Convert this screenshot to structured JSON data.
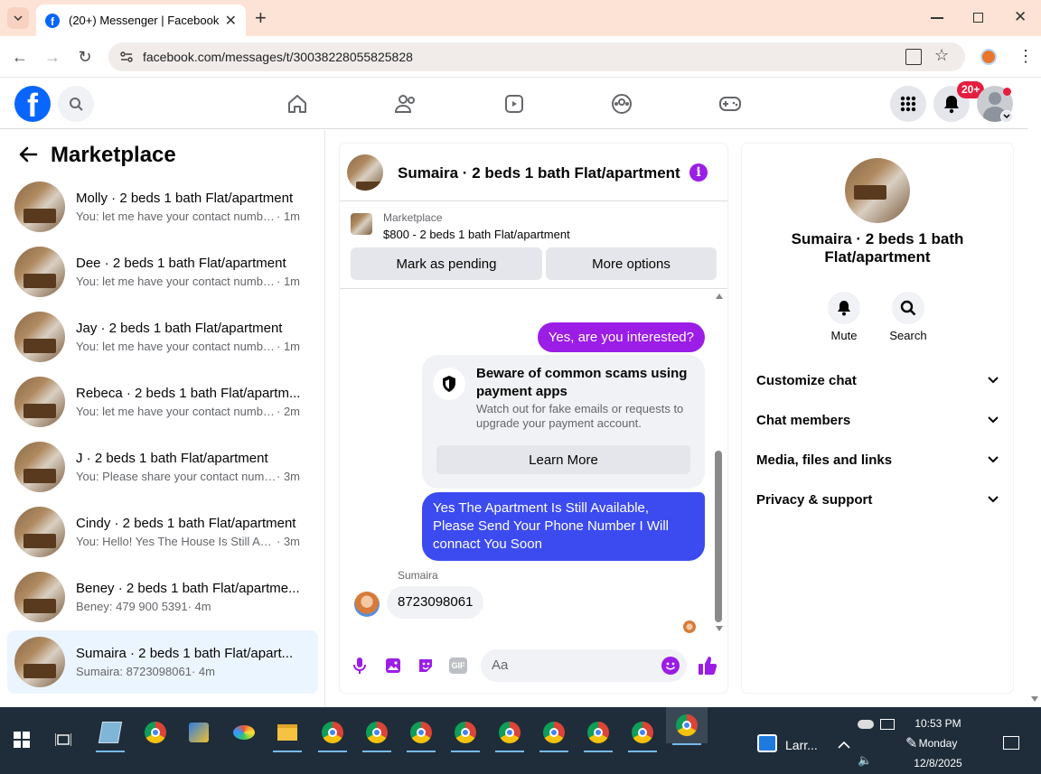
{
  "browser": {
    "tab_title": "(20+) Messenger | Facebook",
    "url": "facebook.com/messages/t/30038228055825828"
  },
  "header": {
    "notif_badge": "20+"
  },
  "sidebar": {
    "title": "Marketplace",
    "conversations": [
      {
        "name": "Molly · 2 beds 1 bath Flat/apartment",
        "preview": "You: let me have your contact numbe...",
        "time": "· 1m"
      },
      {
        "name": "Dee · 2 beds 1 bath Flat/apartment",
        "preview": "You: let me have your contact numbe...",
        "time": "· 1m"
      },
      {
        "name": "Jay · 2 beds 1 bath Flat/apartment",
        "preview": "You: let me have your contact numbe...",
        "time": "· 1m"
      },
      {
        "name": "Rebeca · 2 beds 1 bath Flat/apartm...",
        "preview": "You: let me have your contact numbe...",
        "time": "· 2m"
      },
      {
        "name": "J · 2 beds 1 bath Flat/apartment",
        "preview": "You: Please share your contact numb...",
        "time": "· 3m"
      },
      {
        "name": "Cindy · 2 beds 1 bath Flat/apartment",
        "preview": "You: Hello! Yes The House Is Still Avail...",
        "time": "· 3m"
      },
      {
        "name": "Beney · 2 beds 1 bath Flat/apartme...",
        "preview": "Beney: 479 900 5391",
        "time": "· 4m"
      },
      {
        "name": "Sumaira · 2 beds 1 bath Flat/apart...",
        "preview": "Sumaira: 8723098061",
        "time": "· 4m"
      }
    ]
  },
  "chat": {
    "title": "Sumaira · 2 beds 1 bath Flat/apartment",
    "listing_source": "Marketplace",
    "listing_desc": "$800 - 2 beds 1 bath Flat/apartment",
    "mark_pending": "Mark as pending",
    "more_options": "More options",
    "msg1": "Yes, are you interested?",
    "warn_title": "Beware of common scams using payment apps",
    "warn_body": "Watch out for fake emails or requests to upgrade your payment account.",
    "learn_more": "Learn More",
    "msg2": "Yes The Apartment Is Still Available, Please Send Your Phone Number I Will connact You Soon",
    "sender_name": "Sumaira",
    "msg3": "8723098061",
    "input_placeholder": "Aa"
  },
  "details": {
    "name": "Sumaira · 2 beds 1 bath Flat/apartment",
    "mute": "Mute",
    "search": "Search",
    "sections": [
      "Customize chat",
      "Chat members",
      "Media, files and links",
      "Privacy & support"
    ]
  },
  "taskbar": {
    "tray_app": "Larr...",
    "time": "10:53 PM",
    "day": "Monday",
    "date": "12/8/2025"
  },
  "colors": {
    "fb_blue": "#0866ff",
    "accent_purple": "#9b1de6",
    "outgoing_blue": "#3c4bf0"
  }
}
